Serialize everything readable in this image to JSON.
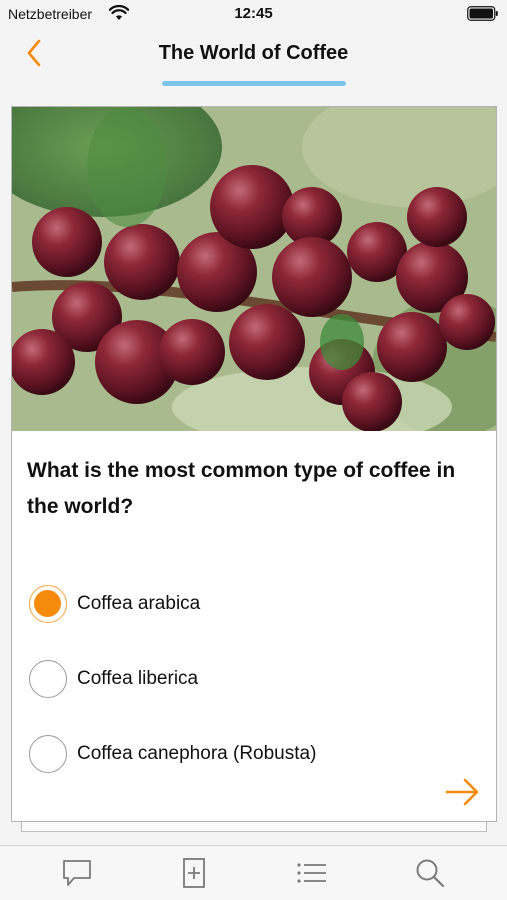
{
  "status_bar": {
    "carrier": "Netzbetreiber",
    "time": "12:45"
  },
  "nav": {
    "title": "The World of Coffee",
    "back_icon": "chevron-left-icon",
    "progress_fraction": 1.0
  },
  "colors": {
    "accent_orange": "#f58a0b",
    "progress_blue": "#7cc3ea",
    "icon_gray": "#7a7a7a"
  },
  "quiz": {
    "question": "What is the most common type of coffee in the world?",
    "answers": [
      {
        "label": "Coffea arabica",
        "selected": true
      },
      {
        "label": "Coffea liberica",
        "selected": false
      },
      {
        "label": "Coffea canephora (Robusta)",
        "selected": false
      }
    ],
    "next_icon": "arrow-right-icon"
  },
  "tab_bar": {
    "tabs": [
      {
        "icon": "speech-bubble-icon"
      },
      {
        "icon": "add-document-icon"
      },
      {
        "icon": "list-icon"
      },
      {
        "icon": "search-icon"
      }
    ]
  }
}
